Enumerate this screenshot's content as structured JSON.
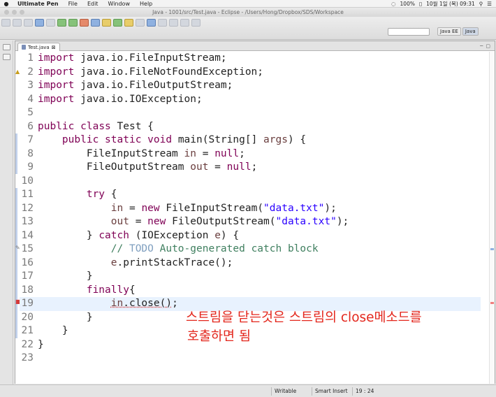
{
  "menubar": {
    "apple": "",
    "items": [
      "Ultimate Pen",
      "File",
      "Edit",
      "Window",
      "Help"
    ],
    "status": {
      "battery": "100%",
      "datetime": "10월 1일 (목)  09:31"
    }
  },
  "window": {
    "title": "Java - 1001/src/Test.java - Eclipse - /Users/Hong/Dropbox/SDS/Workspace"
  },
  "toolbar": {
    "perspectives": [
      {
        "label": "Java EE"
      },
      {
        "label": "Java"
      }
    ]
  },
  "editor": {
    "tab": {
      "label": "Test.java",
      "close": "⊠"
    },
    "lines": [
      {
        "n": "1",
        "html": "<span class='kw'>import</span> java.io.FileInputStream;"
      },
      {
        "n": "2",
        "html": "<span class='kw'>import</span> java.io.FileNotFoundException;"
      },
      {
        "n": "3",
        "html": "<span class='kw'>import</span> java.io.FileOutputStream;"
      },
      {
        "n": "4",
        "html": "<span class='kw'>import</span> java.io.IOException;"
      },
      {
        "n": "5",
        "html": ""
      },
      {
        "n": "6",
        "html": "<span class='kw'>public</span> <span class='kw'>class</span> Test {"
      },
      {
        "n": "7",
        "html": "    <span class='kw'>public</span> <span class='kw'>static</span> <span class='kw'>void</span> main(String[] <span class='var'>args</span>) {"
      },
      {
        "n": "8",
        "html": "        FileInputStream <span class='var'>in</span> = <span class='kw'>null</span>;"
      },
      {
        "n": "9",
        "html": "        FileOutputStream <span class='var'>out</span> = <span class='kw'>null</span>;"
      },
      {
        "n": "10",
        "html": ""
      },
      {
        "n": "11",
        "html": "        <span class='kw'>try</span> {"
      },
      {
        "n": "12",
        "html": "            <span class='var'>in</span> = <span class='kw'>new</span> FileInputStream(<span class='str'>\"data.txt\"</span>);"
      },
      {
        "n": "13",
        "html": "            <span class='var'>out</span> = <span class='kw'>new</span> FileOutputStream(<span class='str'>\"data.txt\"</span>);"
      },
      {
        "n": "14",
        "html": "        } <span class='kw'>catch</span> (IOException <span class='var'>e</span>) {"
      },
      {
        "n": "15",
        "html": "            <span class='cmt'>// </span><span class='todo'>TODO</span><span class='cmt'> Auto-generated catch block</span>"
      },
      {
        "n": "16",
        "html": "            <span class='var'>e</span>.printStackTrace();"
      },
      {
        "n": "17",
        "html": "        }"
      },
      {
        "n": "18",
        "html": "        <span class='kw'>finally</span>{"
      },
      {
        "n": "19",
        "html": "            <span class='underline'><span class='var'>in</span>.close()</span>;"
      },
      {
        "n": "20",
        "html": "        }"
      },
      {
        "n": "21",
        "html": "    }"
      },
      {
        "n": "22",
        "html": "}"
      },
      {
        "n": "23",
        "html": ""
      }
    ],
    "current_line": "19",
    "note_line1": "스트림을 닫는것은 스트림의 close메소드를",
    "note_line2": "호출하면 됨"
  },
  "status": {
    "mode": "Writable",
    "insert": "Smart Insert",
    "position": "19 : 24"
  },
  "colors": {
    "keyword": "#7f0055",
    "string": "#2a00ff",
    "comment": "#3f7f5f",
    "note": "#e3261c"
  }
}
